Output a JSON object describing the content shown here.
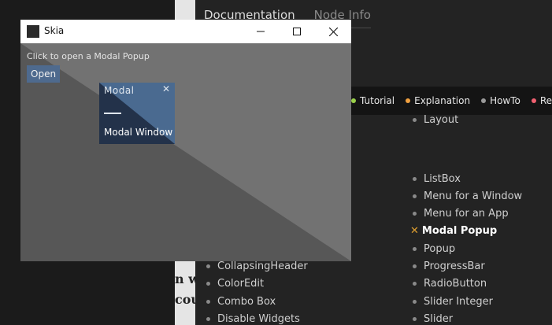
{
  "doc": {
    "tabs": [
      {
        "label": "Documentation",
        "active": true
      },
      {
        "label": "Node Info",
        "active": false
      }
    ],
    "legend": [
      {
        "label": "Tutorial",
        "color": "#9ad04a"
      },
      {
        "label": "Explanation",
        "color": "#f0a040"
      },
      {
        "label": "HowTo",
        "color": "#9a9a9a"
      },
      {
        "label": "Referen",
        "color": "#f06070"
      }
    ],
    "left_list": [
      "CollapsingHeader",
      "ColorEdit",
      "Combo Box",
      "Disable Widgets"
    ],
    "right_list_top": "Layout",
    "right_list": [
      {
        "label": "ListBox",
        "current": false
      },
      {
        "label": "Menu for a Window",
        "current": false
      },
      {
        "label": "Menu for an App",
        "current": false
      },
      {
        "label": "Modal Popup",
        "current": true
      },
      {
        "label": "Popup",
        "current": false
      },
      {
        "label": "ProgressBar",
        "current": false
      },
      {
        "label": "RadioButton",
        "current": false
      },
      {
        "label": "Slider Integer",
        "current": false
      },
      {
        "label": "Slider",
        "current": false
      }
    ],
    "left_text": [
      "n w",
      "cou"
    ]
  },
  "window": {
    "title": "Skia",
    "hint": "Click to open a Modal Popup",
    "open_label": "Open",
    "modal": {
      "title": "Modal",
      "label": "Modal Window"
    }
  },
  "colors": {
    "accent": "#4e6a8e",
    "current_marker": "#e0a030"
  }
}
